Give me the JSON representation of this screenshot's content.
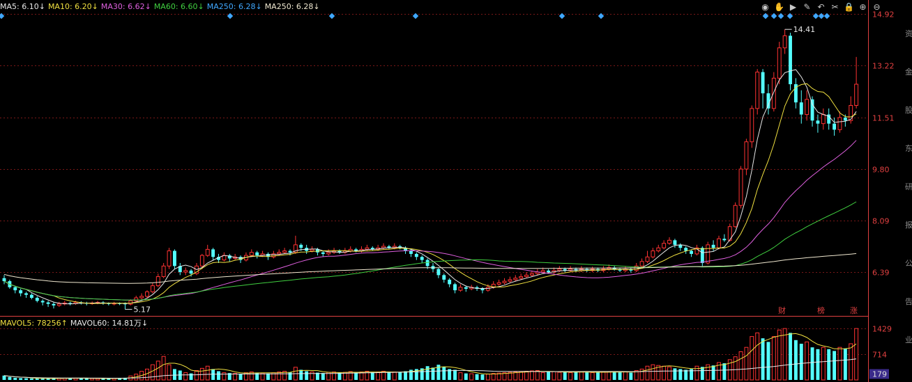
{
  "legend_price": [
    {
      "label": "MA5: 6.10",
      "arrow": "↓",
      "color": "#e8e8e8"
    },
    {
      "label": "MA10: 6.20",
      "arrow": "↓",
      "color": "#f0e040"
    },
    {
      "label": "MA30: 6.62",
      "arrow": "↓",
      "color": "#e060e0"
    },
    {
      "label": "MA60: 6.60",
      "arrow": "↓",
      "color": "#40d040"
    },
    {
      "label": "MA250: 6.28",
      "arrow": "↓",
      "color": "#40a8ff"
    },
    {
      "label": "MA250: 6.28",
      "arrow": "↓",
      "color": "#f0e8d0"
    }
  ],
  "legend_volume": [
    {
      "label": "MAVOL5: 78256",
      "arrow": "↑",
      "color": "#f0e040"
    },
    {
      "label": "MAVOL60: 14.81万",
      "arrow": "↓",
      "color": "#e8e8e8"
    }
  ],
  "toolbar": [
    {
      "name": "eye-icon",
      "glyph": "◉"
    },
    {
      "name": "hand-icon",
      "glyph": "✋"
    },
    {
      "name": "play-icon",
      "glyph": "▶"
    },
    {
      "name": "brush-icon",
      "glyph": "✎"
    },
    {
      "name": "undo-icon",
      "glyph": "↶"
    },
    {
      "name": "scissors-icon",
      "glyph": "✂"
    },
    {
      "name": "lock-icon",
      "glyph": "🔒"
    },
    {
      "name": "zoom-in-icon",
      "glyph": "⊕"
    },
    {
      "name": "zoom-out-icon",
      "glyph": "⊖"
    }
  ],
  "event_tags": [
    "财",
    "榜",
    "涨"
  ],
  "right_strip_chars": [
    "资",
    "金",
    "股",
    "东",
    "研",
    "报",
    "公",
    "告",
    "业"
  ],
  "colors": {
    "up": "#ff3232",
    "down": "#54ffff",
    "grid": "#7a1818",
    "axis": "#e04040"
  },
  "chart_data": [
    {
      "type": "candlestick",
      "title": "",
      "xlabel": "",
      "ylabel": "",
      "y_ticks": [
        6.39,
        8.09,
        9.8,
        11.51,
        13.22,
        14.92
      ],
      "ylim": [
        5.0,
        14.92
      ],
      "annotations": [
        {
          "label": "14.41",
          "value": 14.41
        },
        {
          "label": "5.17",
          "value": 5.17
        }
      ],
      "candles": [
        [
          6.2,
          6.1,
          6.3,
          6.0
        ],
        [
          6.1,
          5.9,
          6.15,
          5.85
        ],
        [
          5.9,
          5.8,
          5.95,
          5.7
        ],
        [
          5.8,
          5.7,
          5.85,
          5.6
        ],
        [
          5.7,
          5.65,
          5.75,
          5.55
        ],
        [
          5.65,
          5.55,
          5.7,
          5.5
        ],
        [
          5.55,
          5.45,
          5.6,
          5.4
        ],
        [
          5.45,
          5.4,
          5.5,
          5.3
        ],
        [
          5.4,
          5.35,
          5.45,
          5.25
        ],
        [
          5.35,
          5.3,
          5.4,
          5.2
        ],
        [
          5.3,
          5.35,
          5.42,
          5.25
        ],
        [
          5.35,
          5.38,
          5.45,
          5.3
        ],
        [
          5.38,
          5.36,
          5.42,
          5.3
        ],
        [
          5.36,
          5.4,
          5.45,
          5.32
        ],
        [
          5.4,
          5.38,
          5.44,
          5.33
        ],
        [
          5.38,
          5.36,
          5.42,
          5.3
        ],
        [
          5.36,
          5.38,
          5.43,
          5.32
        ],
        [
          5.38,
          5.4,
          5.45,
          5.34
        ],
        [
          5.4,
          5.37,
          5.44,
          5.32
        ],
        [
          5.37,
          5.35,
          5.4,
          5.3
        ],
        [
          5.35,
          5.37,
          5.42,
          5.3
        ],
        [
          5.37,
          5.36,
          5.4,
          5.31
        ],
        [
          5.36,
          5.34,
          5.4,
          5.17
        ],
        [
          5.34,
          5.45,
          5.5,
          5.3
        ],
        [
          5.45,
          5.55,
          5.62,
          5.4
        ],
        [
          5.55,
          5.6,
          5.7,
          5.5
        ],
        [
          5.6,
          5.75,
          5.8,
          5.55
        ],
        [
          5.75,
          5.95,
          6.05,
          5.7
        ],
        [
          5.95,
          6.25,
          6.35,
          5.9
        ],
        [
          6.25,
          6.6,
          6.7,
          6.2
        ],
        [
          6.6,
          7.1,
          7.2,
          6.5
        ],
        [
          7.1,
          6.6,
          7.15,
          6.5
        ],
        [
          6.6,
          6.4,
          6.7,
          6.3
        ],
        [
          6.4,
          6.45,
          6.55,
          6.3
        ],
        [
          6.45,
          6.35,
          6.5,
          6.25
        ],
        [
          6.35,
          6.6,
          6.7,
          6.3
        ],
        [
          6.6,
          6.95,
          7.0,
          6.5
        ],
        [
          6.95,
          7.15,
          7.3,
          6.9
        ],
        [
          7.15,
          6.9,
          7.2,
          6.8
        ],
        [
          6.9,
          6.8,
          7.0,
          6.7
        ],
        [
          6.8,
          6.95,
          7.05,
          6.75
        ],
        [
          6.95,
          6.85,
          7.0,
          6.75
        ],
        [
          6.85,
          6.9,
          7.0,
          6.8
        ],
        [
          6.9,
          6.8,
          6.95,
          6.7
        ],
        [
          6.8,
          6.95,
          7.05,
          6.75
        ],
        [
          6.95,
          7.05,
          7.15,
          6.9
        ],
        [
          7.05,
          6.95,
          7.1,
          6.85
        ],
        [
          6.95,
          7.0,
          7.1,
          6.9
        ],
        [
          7.0,
          6.9,
          7.05,
          6.8
        ],
        [
          6.9,
          7.0,
          7.1,
          6.85
        ],
        [
          7.0,
          7.05,
          7.15,
          6.95
        ],
        [
          7.05,
          7.1,
          7.2,
          7.0
        ],
        [
          7.1,
          7.05,
          7.15,
          6.95
        ],
        [
          7.05,
          7.3,
          7.6,
          7.0
        ],
        [
          7.3,
          7.2,
          7.35,
          7.1
        ],
        [
          7.2,
          7.1,
          7.3,
          7.0
        ],
        [
          7.1,
          7.15,
          7.25,
          7.05
        ],
        [
          7.15,
          7.05,
          7.2,
          6.95
        ],
        [
          7.05,
          7.0,
          7.1,
          6.9
        ],
        [
          7.0,
          7.05,
          7.15,
          6.95
        ],
        [
          7.05,
          7.1,
          7.2,
          7.0
        ],
        [
          7.1,
          7.05,
          7.15,
          7.0
        ],
        [
          7.05,
          7.1,
          7.2,
          7.0
        ],
        [
          7.1,
          7.15,
          7.25,
          7.05
        ],
        [
          7.15,
          7.1,
          7.2,
          7.05
        ],
        [
          7.1,
          7.15,
          7.25,
          7.05
        ],
        [
          7.15,
          7.2,
          7.3,
          7.1
        ],
        [
          7.2,
          7.15,
          7.25,
          7.1
        ],
        [
          7.15,
          7.2,
          7.3,
          7.1
        ],
        [
          7.2,
          7.25,
          7.35,
          7.15
        ],
        [
          7.25,
          7.2,
          7.3,
          7.15
        ],
        [
          7.2,
          7.25,
          7.35,
          7.15
        ],
        [
          7.25,
          7.2,
          7.3,
          7.15
        ],
        [
          7.2,
          7.1,
          7.25,
          7.0
        ],
        [
          7.1,
          7.0,
          7.15,
          6.9
        ],
        [
          7.0,
          6.9,
          7.05,
          6.8
        ],
        [
          6.9,
          6.8,
          6.95,
          6.7
        ],
        [
          6.8,
          6.6,
          6.85,
          6.5
        ],
        [
          6.6,
          6.5,
          6.7,
          6.4
        ],
        [
          6.5,
          6.3,
          6.55,
          6.2
        ],
        [
          6.3,
          6.15,
          6.35,
          6.05
        ],
        [
          6.15,
          6.0,
          6.2,
          5.9
        ],
        [
          6.0,
          5.8,
          6.05,
          5.7
        ],
        [
          5.8,
          5.9,
          6.0,
          5.75
        ],
        [
          5.9,
          5.85,
          5.95,
          5.75
        ],
        [
          5.85,
          5.9,
          5.98,
          5.8
        ],
        [
          5.9,
          5.85,
          5.95,
          5.78
        ],
        [
          5.85,
          5.8,
          5.9,
          5.7
        ],
        [
          5.8,
          5.9,
          6.0,
          5.75
        ],
        [
          5.9,
          6.0,
          6.1,
          5.85
        ],
        [
          6.0,
          6.05,
          6.15,
          5.95
        ],
        [
          6.05,
          6.1,
          6.2,
          6.0
        ],
        [
          6.1,
          6.15,
          6.25,
          6.05
        ],
        [
          6.15,
          6.2,
          6.3,
          6.1
        ],
        [
          6.2,
          6.25,
          6.35,
          6.15
        ],
        [
          6.25,
          6.3,
          6.4,
          6.2
        ],
        [
          6.3,
          6.35,
          6.45,
          6.25
        ],
        [
          6.35,
          6.4,
          6.5,
          6.3
        ],
        [
          6.4,
          6.45,
          6.55,
          6.35
        ],
        [
          6.45,
          6.4,
          6.5,
          6.35
        ],
        [
          6.4,
          6.45,
          6.55,
          6.35
        ],
        [
          6.45,
          6.5,
          6.6,
          6.4
        ],
        [
          6.5,
          6.45,
          6.55,
          6.4
        ],
        [
          6.45,
          6.5,
          6.6,
          6.4
        ],
        [
          6.5,
          6.45,
          6.55,
          6.4
        ],
        [
          6.45,
          6.5,
          6.6,
          6.4
        ],
        [
          6.5,
          6.45,
          6.55,
          6.4
        ],
        [
          6.45,
          6.5,
          6.58,
          6.4
        ],
        [
          6.5,
          6.45,
          6.55,
          6.4
        ],
        [
          6.45,
          6.5,
          6.6,
          6.4
        ],
        [
          6.5,
          6.55,
          6.65,
          6.45
        ],
        [
          6.55,
          6.5,
          6.6,
          6.45
        ],
        [
          6.5,
          6.45,
          6.55,
          6.4
        ],
        [
          6.45,
          6.5,
          6.58,
          6.4
        ],
        [
          6.5,
          6.45,
          6.55,
          6.38
        ],
        [
          6.45,
          6.6,
          6.7,
          6.4
        ],
        [
          6.6,
          6.75,
          6.85,
          6.55
        ],
        [
          6.75,
          6.9,
          7.1,
          6.7
        ],
        [
          6.9,
          7.1,
          7.2,
          6.85
        ],
        [
          7.1,
          7.2,
          7.3,
          7.05
        ],
        [
          7.2,
          7.35,
          7.45,
          7.15
        ],
        [
          7.35,
          7.45,
          7.55,
          7.3
        ],
        [
          7.45,
          7.3,
          7.5,
          7.2
        ],
        [
          7.3,
          7.2,
          7.35,
          7.1
        ],
        [
          7.2,
          7.1,
          7.25,
          7.0
        ],
        [
          7.1,
          7.0,
          7.15,
          6.9
        ],
        [
          7.0,
          7.2,
          7.3,
          6.95
        ],
        [
          7.2,
          6.7,
          7.25,
          6.6
        ],
        [
          6.7,
          7.3,
          7.4,
          6.65
        ],
        [
          7.3,
          7.2,
          7.45,
          7.1
        ],
        [
          7.2,
          7.5,
          7.6,
          7.15
        ],
        [
          7.5,
          7.45,
          7.65,
          7.4
        ],
        [
          7.45,
          7.9,
          8.0,
          7.4
        ],
        [
          7.9,
          8.6,
          8.7,
          7.85
        ],
        [
          8.6,
          9.8,
          9.9,
          8.5
        ],
        [
          9.8,
          10.7,
          10.8,
          9.6
        ],
        [
          10.7,
          11.8,
          11.9,
          10.5
        ],
        [
          11.8,
          13.0,
          13.1,
          11.6
        ],
        [
          13.0,
          12.3,
          13.1,
          11.8
        ],
        [
          12.3,
          11.8,
          12.6,
          11.6
        ],
        [
          11.8,
          12.8,
          13.0,
          11.7
        ],
        [
          12.8,
          13.8,
          14.0,
          12.6
        ],
        [
          13.8,
          14.2,
          14.41,
          13.6
        ],
        [
          14.2,
          12.6,
          14.3,
          12.4
        ],
        [
          12.6,
          12.0,
          12.8,
          11.8
        ],
        [
          12.0,
          11.6,
          12.4,
          11.3
        ],
        [
          11.6,
          12.1,
          12.4,
          11.4
        ],
        [
          12.1,
          11.4,
          12.2,
          11.2
        ],
        [
          11.4,
          11.3,
          11.6,
          11.0
        ],
        [
          11.3,
          11.6,
          11.8,
          11.1
        ],
        [
          11.6,
          11.3,
          11.8,
          11.1
        ],
        [
          11.3,
          11.1,
          11.5,
          10.9
        ],
        [
          11.1,
          11.5,
          11.7,
          11.0
        ],
        [
          11.5,
          11.4,
          11.6,
          11.2
        ],
        [
          11.4,
          11.9,
          12.2,
          11.3
        ],
        [
          11.9,
          12.6,
          13.5,
          11.8
        ]
      ]
    },
    {
      "type": "bar",
      "title": "",
      "y_ticks": [
        179,
        714,
        1429
      ],
      "ylim": [
        0,
        1500
      ],
      "volumes": [
        120,
        80,
        60,
        50,
        45,
        40,
        38,
        35,
        40,
        42,
        50,
        48,
        45,
        44,
        42,
        40,
        38,
        36,
        40,
        38,
        42,
        45,
        60,
        110,
        160,
        240,
        300,
        420,
        520,
        650,
        420,
        300,
        260,
        200,
        180,
        260,
        320,
        380,
        300,
        240,
        200,
        190,
        180,
        170,
        200,
        220,
        200,
        190,
        180,
        200,
        220,
        240,
        210,
        350,
        280,
        240,
        220,
        200,
        190,
        210,
        220,
        200,
        210,
        230,
        200,
        220,
        240,
        210,
        220,
        240,
        200,
        220,
        210,
        240,
        280,
        300,
        320,
        380,
        340,
        420,
        360,
        300,
        280,
        200,
        180,
        170,
        160,
        150,
        160,
        180,
        190,
        200,
        210,
        220,
        230,
        240,
        250,
        260,
        200,
        220,
        230,
        210,
        220,
        200,
        230,
        220,
        210,
        200,
        210,
        220,
        230,
        220,
        210,
        230,
        200,
        260,
        300,
        380,
        420,
        400,
        380,
        360,
        320,
        300,
        280,
        300,
        380,
        360,
        420,
        400,
        480,
        460,
        560,
        640,
        780,
        900,
        1200,
        1300,
        1150,
        1050,
        1200,
        1380,
        1420,
        1300,
        1100,
        1000,
        1050,
        900,
        850,
        900,
        850,
        800,
        900,
        870,
        1000,
        1420
      ]
    }
  ]
}
